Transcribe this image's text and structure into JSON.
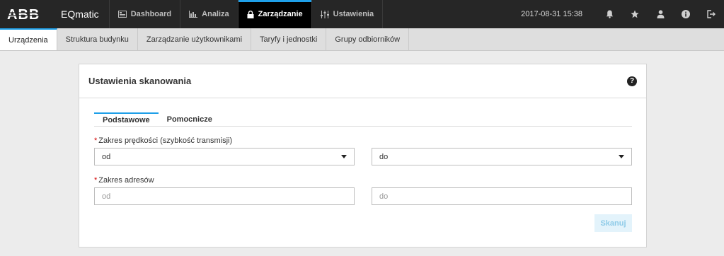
{
  "app": {
    "logo": "ABB",
    "title": "EQmatic"
  },
  "nav": [
    {
      "label": "Dashboard",
      "icon": "dashboard-icon"
    },
    {
      "label": "Analiza",
      "icon": "bar-chart-icon"
    },
    {
      "label": "Zarządzanie",
      "icon": "lock-icon",
      "active": true
    },
    {
      "label": "Ustawienia",
      "icon": "sliders-icon"
    }
  ],
  "datetime": "2017-08-31 15:38",
  "top_icons": [
    "bell-icon",
    "star-icon",
    "user-icon",
    "info-icon",
    "logout-icon"
  ],
  "subtabs": [
    {
      "label": "Urządzenia",
      "active": true
    },
    {
      "label": "Struktura budynku"
    },
    {
      "label": "Zarządzanie użytkownikami"
    },
    {
      "label": "Taryfy i jednostki"
    },
    {
      "label": "Grupy odbiorników"
    }
  ],
  "card": {
    "title": "Ustawienia skanowania",
    "tabs": [
      {
        "label": "Podstawowe",
        "active": true
      },
      {
        "label": "Pomocnicze"
      }
    ],
    "speed": {
      "label": "Zakres prędkości (szybkość transmisji)",
      "from_value": "od",
      "to_value": "do"
    },
    "address": {
      "label": "Zakres adresów",
      "from_placeholder": "od",
      "to_placeholder": "do"
    },
    "scan_button": "Skanuj"
  },
  "colors": {
    "accent": "#1e9fe8",
    "topbar": "#262626",
    "required": "#d40000"
  }
}
